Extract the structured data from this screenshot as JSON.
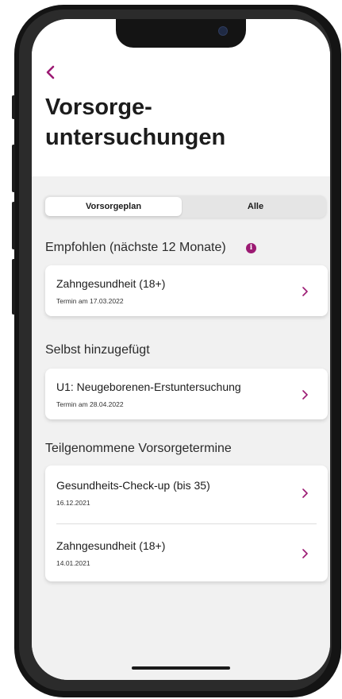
{
  "header": {
    "back_icon": "chevron-left-icon",
    "title": "Vorsorge-\nuntersuchungen"
  },
  "tabs": {
    "items": [
      {
        "label": "Vorsorgeplan",
        "active": true
      },
      {
        "label": "Alle",
        "active": false
      }
    ]
  },
  "sections": [
    {
      "title": "Empfohlen (nächste 12 Monate)",
      "info_icon": "info-icon",
      "items": [
        {
          "title": "Zahngesundheit (18+)",
          "subtitle": "Termin am 17.03.2022"
        }
      ]
    },
    {
      "title": "Selbst hinzugefügt",
      "items": [
        {
          "title": "U1: Neugeborenen-Erstuntersuchung",
          "subtitle": "Termin am 28.04.2022"
        }
      ]
    },
    {
      "title": "Teilgenommene Vorsorgetermine",
      "items": [
        {
          "title": "Gesundheits-Check-up (bis 35)",
          "subtitle": "16.12.2021"
        },
        {
          "title": "Zahngesundheit (18+)",
          "subtitle": "14.01.2021"
        }
      ]
    }
  ],
  "colors": {
    "accent": "#9c1a73",
    "background": "#f1f1f1",
    "card": "#ffffff"
  }
}
